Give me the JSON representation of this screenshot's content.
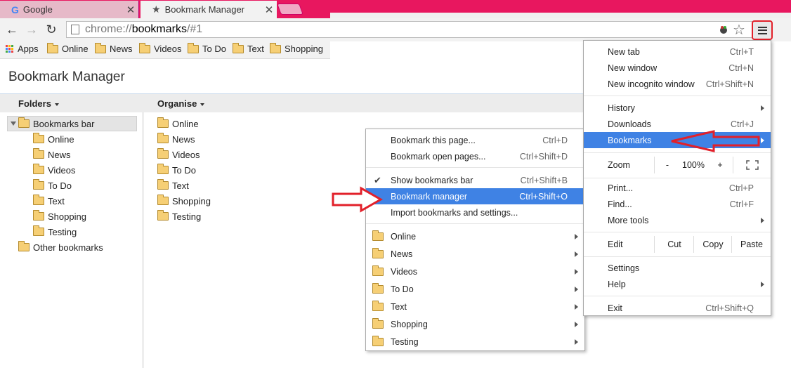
{
  "colors": {
    "titlebar": "#e8175f",
    "highlight": "#3f82e4",
    "annotation": "#e2202a",
    "folder": "#f6cf75"
  },
  "tabs": [
    {
      "title": "Google",
      "icon": "google-g-icon"
    },
    {
      "title": "Bookmark Manager",
      "icon": "star-icon"
    }
  ],
  "address": {
    "scheme": "chrome://",
    "host": "bookmarks",
    "path": "/#1"
  },
  "bookmarks_bar": {
    "apps_label": "Apps",
    "items": [
      "Online",
      "News",
      "Videos",
      "To Do",
      "Text",
      "Shopping"
    ]
  },
  "page": {
    "title": "Bookmark Manager",
    "folders_label": "Folders",
    "organise_label": "Organise",
    "tree_root": "Bookmarks bar",
    "tree_children": [
      "Online",
      "News",
      "Videos",
      "To Do",
      "Text",
      "Shopping",
      "Testing"
    ],
    "tree_other": "Other bookmarks",
    "list_items": [
      "Online",
      "News",
      "Videos",
      "To Do",
      "Text",
      "Shopping",
      "Testing"
    ]
  },
  "bookmarks_submenu": {
    "bookmark_page": {
      "label": "Bookmark this page...",
      "shortcut": "Ctrl+D"
    },
    "bookmark_open": {
      "label": "Bookmark open pages...",
      "shortcut": "Ctrl+Shift+D"
    },
    "show_bar": {
      "label": "Show bookmarks bar",
      "shortcut": "Ctrl+Shift+B"
    },
    "manager": {
      "label": "Bookmark manager",
      "shortcut": "Ctrl+Shift+O"
    },
    "import": {
      "label": "Import bookmarks and settings..."
    },
    "folders": [
      "Online",
      "News",
      "Videos",
      "To Do",
      "Text",
      "Shopping",
      "Testing"
    ]
  },
  "main_menu": {
    "new_tab": {
      "label": "New tab",
      "shortcut": "Ctrl+T"
    },
    "new_window": {
      "label": "New window",
      "shortcut": "Ctrl+N"
    },
    "incognito": {
      "label": "New incognito window",
      "shortcut": "Ctrl+Shift+N"
    },
    "history": {
      "label": "History"
    },
    "downloads": {
      "label": "Downloads",
      "shortcut": "Ctrl+J"
    },
    "bookmarks": {
      "label": "Bookmarks"
    },
    "zoom": {
      "label": "Zoom",
      "minus": "-",
      "value": "100%",
      "plus": "+"
    },
    "print": {
      "label": "Print...",
      "shortcut": "Ctrl+P"
    },
    "find": {
      "label": "Find...",
      "shortcut": "Ctrl+F"
    },
    "more_tools": {
      "label": "More tools"
    },
    "edit": {
      "label": "Edit",
      "cut": "Cut",
      "copy": "Copy",
      "paste": "Paste"
    },
    "settings": {
      "label": "Settings"
    },
    "help": {
      "label": "Help"
    },
    "exit": {
      "label": "Exit",
      "shortcut": "Ctrl+Shift+Q"
    }
  }
}
